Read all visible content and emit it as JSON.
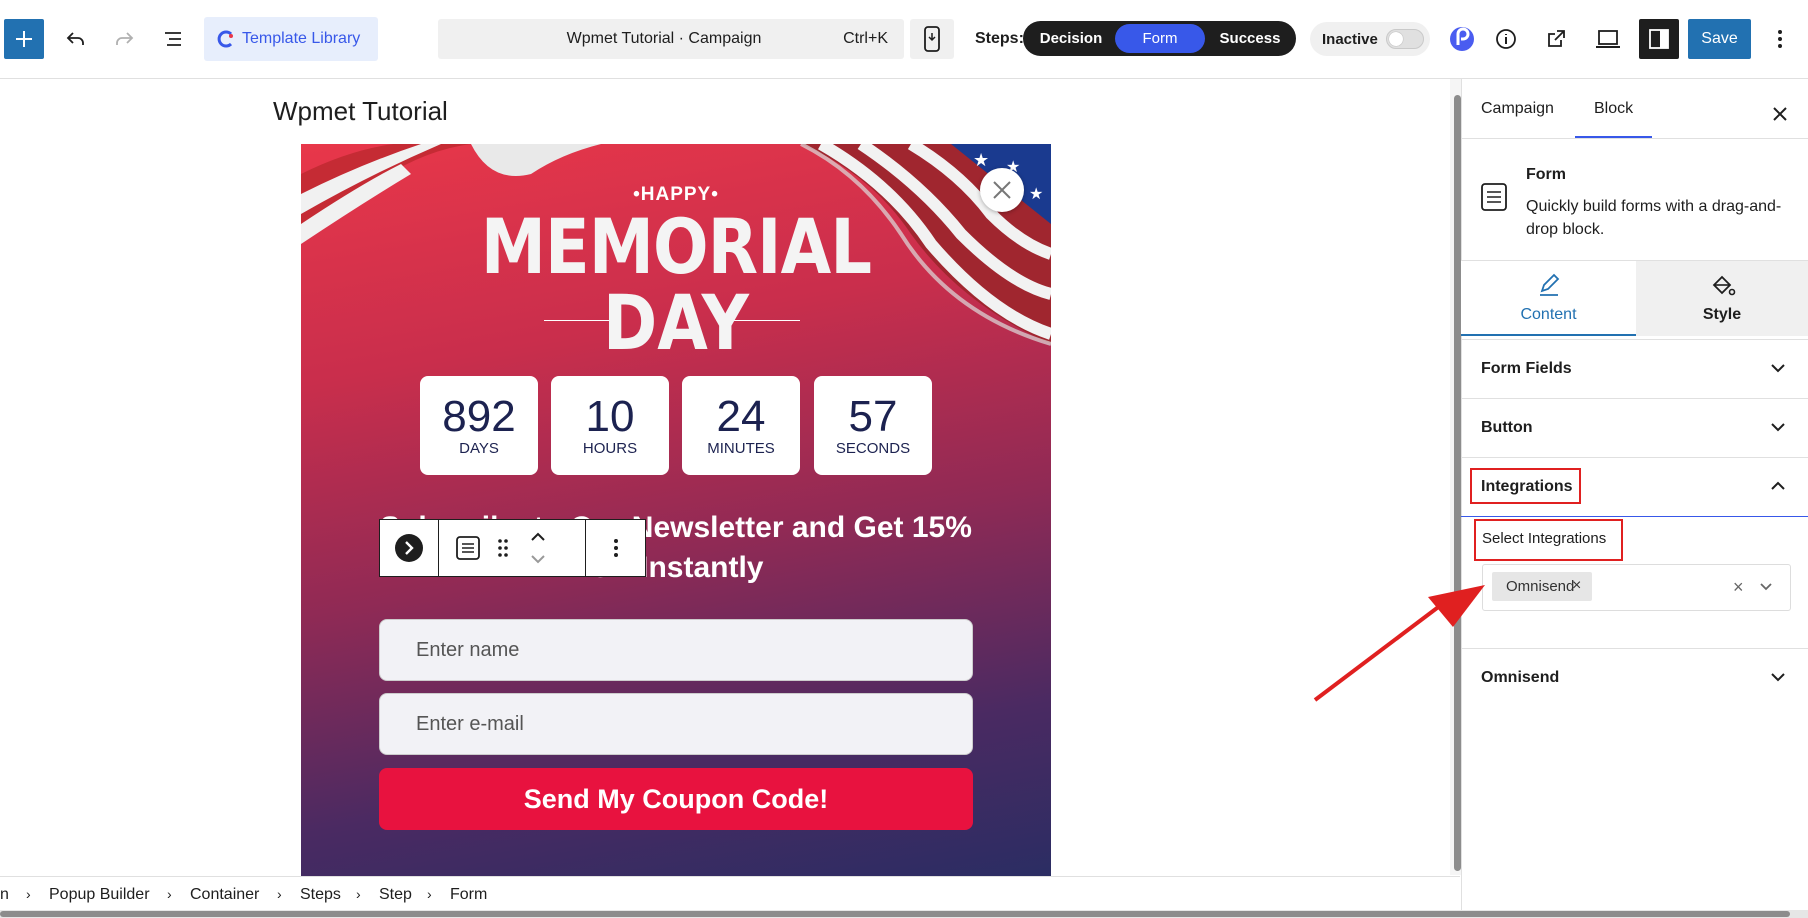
{
  "header": {
    "template_library_label": "Template Library",
    "command_title": "Wpmet Tutorial · Campaign",
    "command_shortcut": "Ctrl+K",
    "steps_label": "Steps:",
    "steps": [
      {
        "label": "Decision",
        "active": false
      },
      {
        "label": "Form",
        "active": true
      },
      {
        "label": "Success",
        "active": false
      }
    ],
    "status_label": "Inactive",
    "save_label": "Save"
  },
  "canvas": {
    "page_title": "Wpmet Tutorial",
    "popup": {
      "happy_text": "•HAPPY•",
      "memorial_text": "MEMORIAL",
      "day_text": "DAY",
      "countdown": [
        {
          "value": "892",
          "label": "DAYS"
        },
        {
          "value": "10",
          "label": "HOURS"
        },
        {
          "value": "24",
          "label": "MINUTES"
        },
        {
          "value": "57",
          "label": "SECONDS"
        }
      ],
      "headline": "Subscribe to Our Newsletter and Get 15% Off Instantly",
      "name_placeholder": "Enter name",
      "email_placeholder": "Enter e-mail",
      "submit_label": "Send My Coupon Code!"
    }
  },
  "breadcrumb": [
    "n",
    "Popup Builder",
    "Container",
    "Steps",
    "Step",
    "Form"
  ],
  "sidebar": {
    "tabs": [
      {
        "label": "Campaign",
        "active": false
      },
      {
        "label": "Block",
        "active": true
      }
    ],
    "block_card": {
      "title": "Form",
      "description": "Quickly build forms with a drag-and-drop block."
    },
    "mode_tabs": [
      {
        "label": "Content",
        "active": true
      },
      {
        "label": "Style",
        "active": false
      }
    ],
    "panels": {
      "form_fields": "Form Fields",
      "button": "Button",
      "integrations": "Integrations",
      "omnisend": "Omnisend"
    },
    "integrations": {
      "select_label": "Select Integrations",
      "selected": [
        "Omnisend"
      ]
    }
  },
  "colors": {
    "accent": "#3858e9",
    "primary_button": "#2271b1",
    "submit_button": "#e8123f",
    "highlight_box": "#e02020"
  }
}
